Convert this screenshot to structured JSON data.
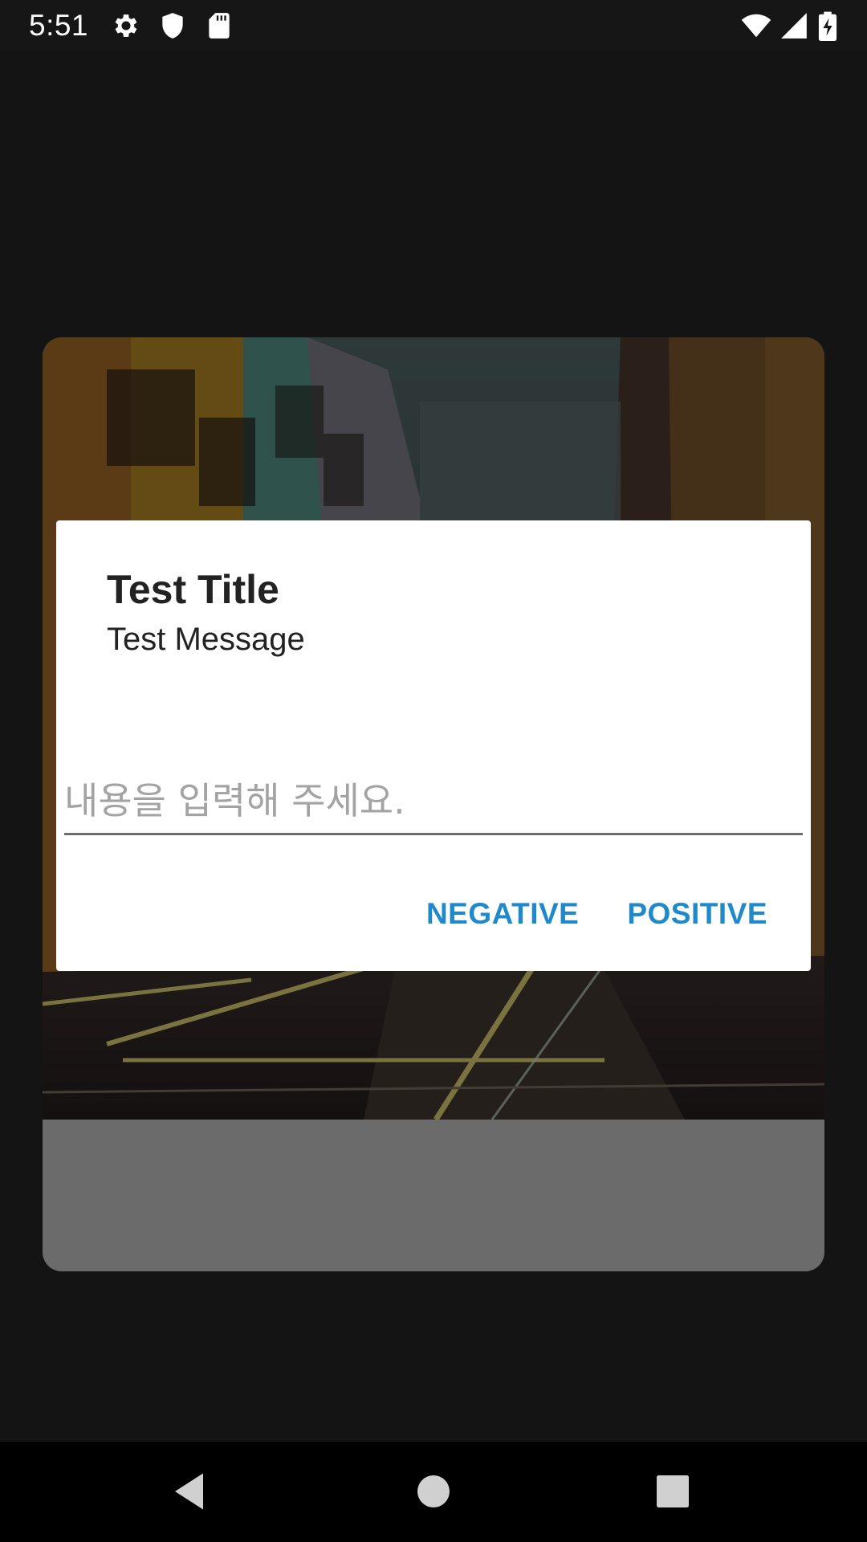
{
  "status_bar": {
    "time": "5:51",
    "left_icons": [
      "gear-icon",
      "shield-icon",
      "sd-card-icon"
    ],
    "right_icons": [
      "wifi-icon",
      "signal-icon",
      "battery-charging-icon"
    ]
  },
  "dialog": {
    "title": "Test Title",
    "message": "Test Message",
    "input": {
      "value": "",
      "placeholder": "내용을 입력해 주세요."
    },
    "negative_label": "NEGATIVE",
    "positive_label": "POSITIVE",
    "accent_color": "#1f89c9"
  },
  "navigation_bar": {
    "buttons": [
      "back-icon",
      "home-icon",
      "recents-icon"
    ]
  }
}
